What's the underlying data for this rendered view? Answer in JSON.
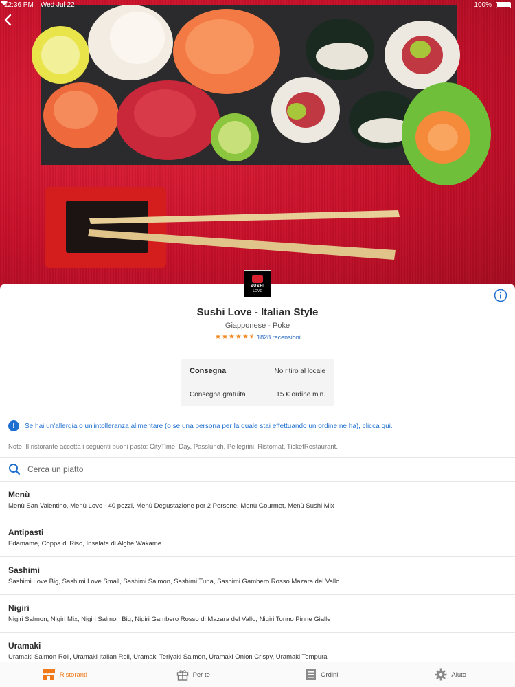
{
  "status_bar": {
    "time": "12:36 PM",
    "date": "Wed Jul 22",
    "battery": "100%"
  },
  "restaurant": {
    "name": "Sushi Love - Italian Style",
    "cuisine": "Giapponese · Poke",
    "rating_stars": 4.5,
    "reviews": "1828 recensioni",
    "logo_line1": "SUSHI",
    "logo_line2": "LOVE"
  },
  "delivery": {
    "header_label": "Consegna",
    "header_value": "No ritiro al locale",
    "fee_label": "Consegna gratuita",
    "fee_value": "15 € ordine min."
  },
  "allergy_text": "Se hai un'allergia o un'intolleranza alimentare (o se una persona per la quale stai effettuando un ordine ne ha), clicca qui.",
  "note": "Note: Il ristorante accetta i seguenti buoni pasto: CityTime, Day, Passlunch, Pellegrini, Ristomat, TicketRestaurant.",
  "search": {
    "placeholder": "Cerca un piatto"
  },
  "categories": [
    {
      "name": "Menù",
      "items": "Menù San Valentino, Menù Love - 40 pezzi, Menù Degustazione per 2 Persone, Menù Gourmet, Menù Sushi Mix"
    },
    {
      "name": "Antipasti",
      "items": "Edamame, Coppa di Riso, Insalata di Alghe Wakame"
    },
    {
      "name": "Sashimi",
      "items": "Sashimi Love Big, Sashimi Love Small, Sashimi Salmon, Sashimi Tuna, Sashimi Gambero Rosso Mazara del Vallo"
    },
    {
      "name": "Nigiri",
      "items": "Nigiri Salmon, Nigiri Mix, Nigiri Salmon Big, Nigiri Gambero Rosso di Mazara del Vallo, Nigiri Tonno Pinne Gialle"
    },
    {
      "name": "Uramaki",
      "items": "Uramaki Salmon Roll, Uramaki Italian Roll, Uramaki Teriyaki Salmon, Uramaki Onion Crispy, Uramaki Tempura"
    }
  ],
  "tabs": [
    {
      "label": "Ristoranti",
      "icon": "storefront-icon",
      "active": true
    },
    {
      "label": "Per te",
      "icon": "gift-icon",
      "active": false
    },
    {
      "label": "Ordini",
      "icon": "receipt-icon",
      "active": false
    },
    {
      "label": "Aiuto",
      "icon": "gear-icon",
      "active": false
    }
  ],
  "colors": {
    "accent": "#f07a1a",
    "link": "#1f6fd0",
    "star": "#f28a24"
  }
}
